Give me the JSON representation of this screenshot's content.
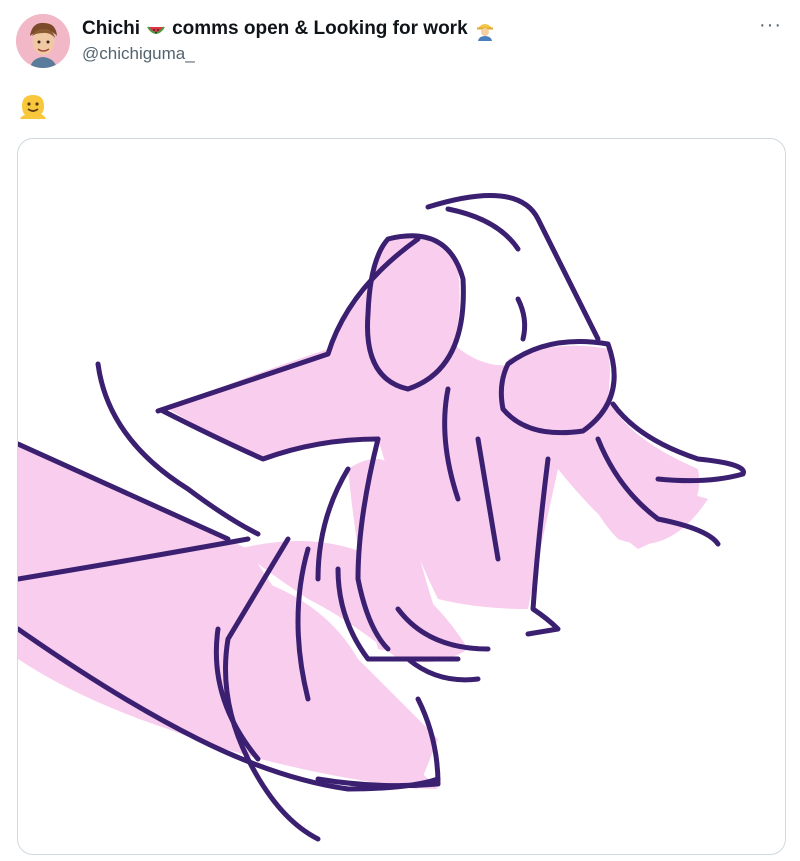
{
  "author": {
    "display_name": "Chichi",
    "display_name_suffix": "comms open & Looking for work",
    "handle": "@chichiguma_"
  },
  "icons": {
    "name_emoji_1": "watermelon-icon",
    "name_emoji_2": "worker-icon",
    "tweet_emoji": "melting-face-icon",
    "more": "more-icon"
  },
  "more_label": "···",
  "colors": {
    "text": "#0f1419",
    "muted": "#536471",
    "border": "#cfd9de",
    "sketch_fill": "#f9cdee",
    "sketch_line": "#3b1f70"
  }
}
